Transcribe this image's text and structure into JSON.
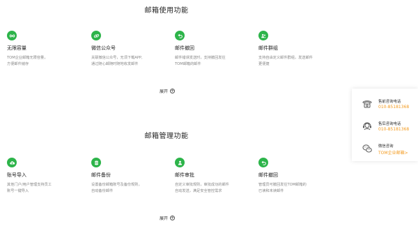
{
  "section1": {
    "title": "邮箱使用功能",
    "features": [
      {
        "icon": "infinity-icon",
        "title": "无限容量",
        "desc": "TOM企业邮箱无限容量，\n方便邮件储存"
      },
      {
        "icon": "link-icon",
        "title": "微信公众号",
        "desc": "关联微信公众号，无须下载APP,\n通过随心邮随时随地收发邮件"
      },
      {
        "icon": "undo-icon",
        "title": "邮件撤回",
        "desc": "邮件错误发送时，支持撤回发往\nTOM邮箱的邮件"
      },
      {
        "icon": "group-icon",
        "title": "邮件群组",
        "desc": "支持自由定义邮件群组，发送邮件\n更便捷"
      }
    ],
    "expand_label": "展开"
  },
  "section2": {
    "title": "邮箱管理功能",
    "features": [
      {
        "icon": "cloud-upload-icon",
        "title": "账号导入",
        "desc": "其他门户/用户管理支持员工\n账号一键导入"
      },
      {
        "icon": "database-icon",
        "title": "邮件备份",
        "desc": "设置备份邮箱账号及备份规则，\n自动备份邮件"
      },
      {
        "icon": "user-check-icon",
        "title": "邮件审批",
        "desc": "自定义审批规则，审批成功的邮件\n自动发送，满足安全管控需求"
      },
      {
        "icon": "undo-icon",
        "title": "邮件撤回",
        "desc": "管理员可撤回发往TOM邮箱的\n已读和未读邮件"
      }
    ],
    "expand_label": "展开"
  },
  "side_panel": {
    "items": [
      {
        "icon": "phone-icon",
        "label": "售前咨询电话",
        "value": "010-85181368"
      },
      {
        "icon": "headset-icon",
        "label": "售后咨询电话",
        "value": "010-85181368"
      },
      {
        "icon": "wechat-icon",
        "label": "微信咨询",
        "value": "TOM企业邮箱>"
      }
    ]
  },
  "colors": {
    "accent": "#2db44a",
    "highlight": "#f39a1e"
  }
}
